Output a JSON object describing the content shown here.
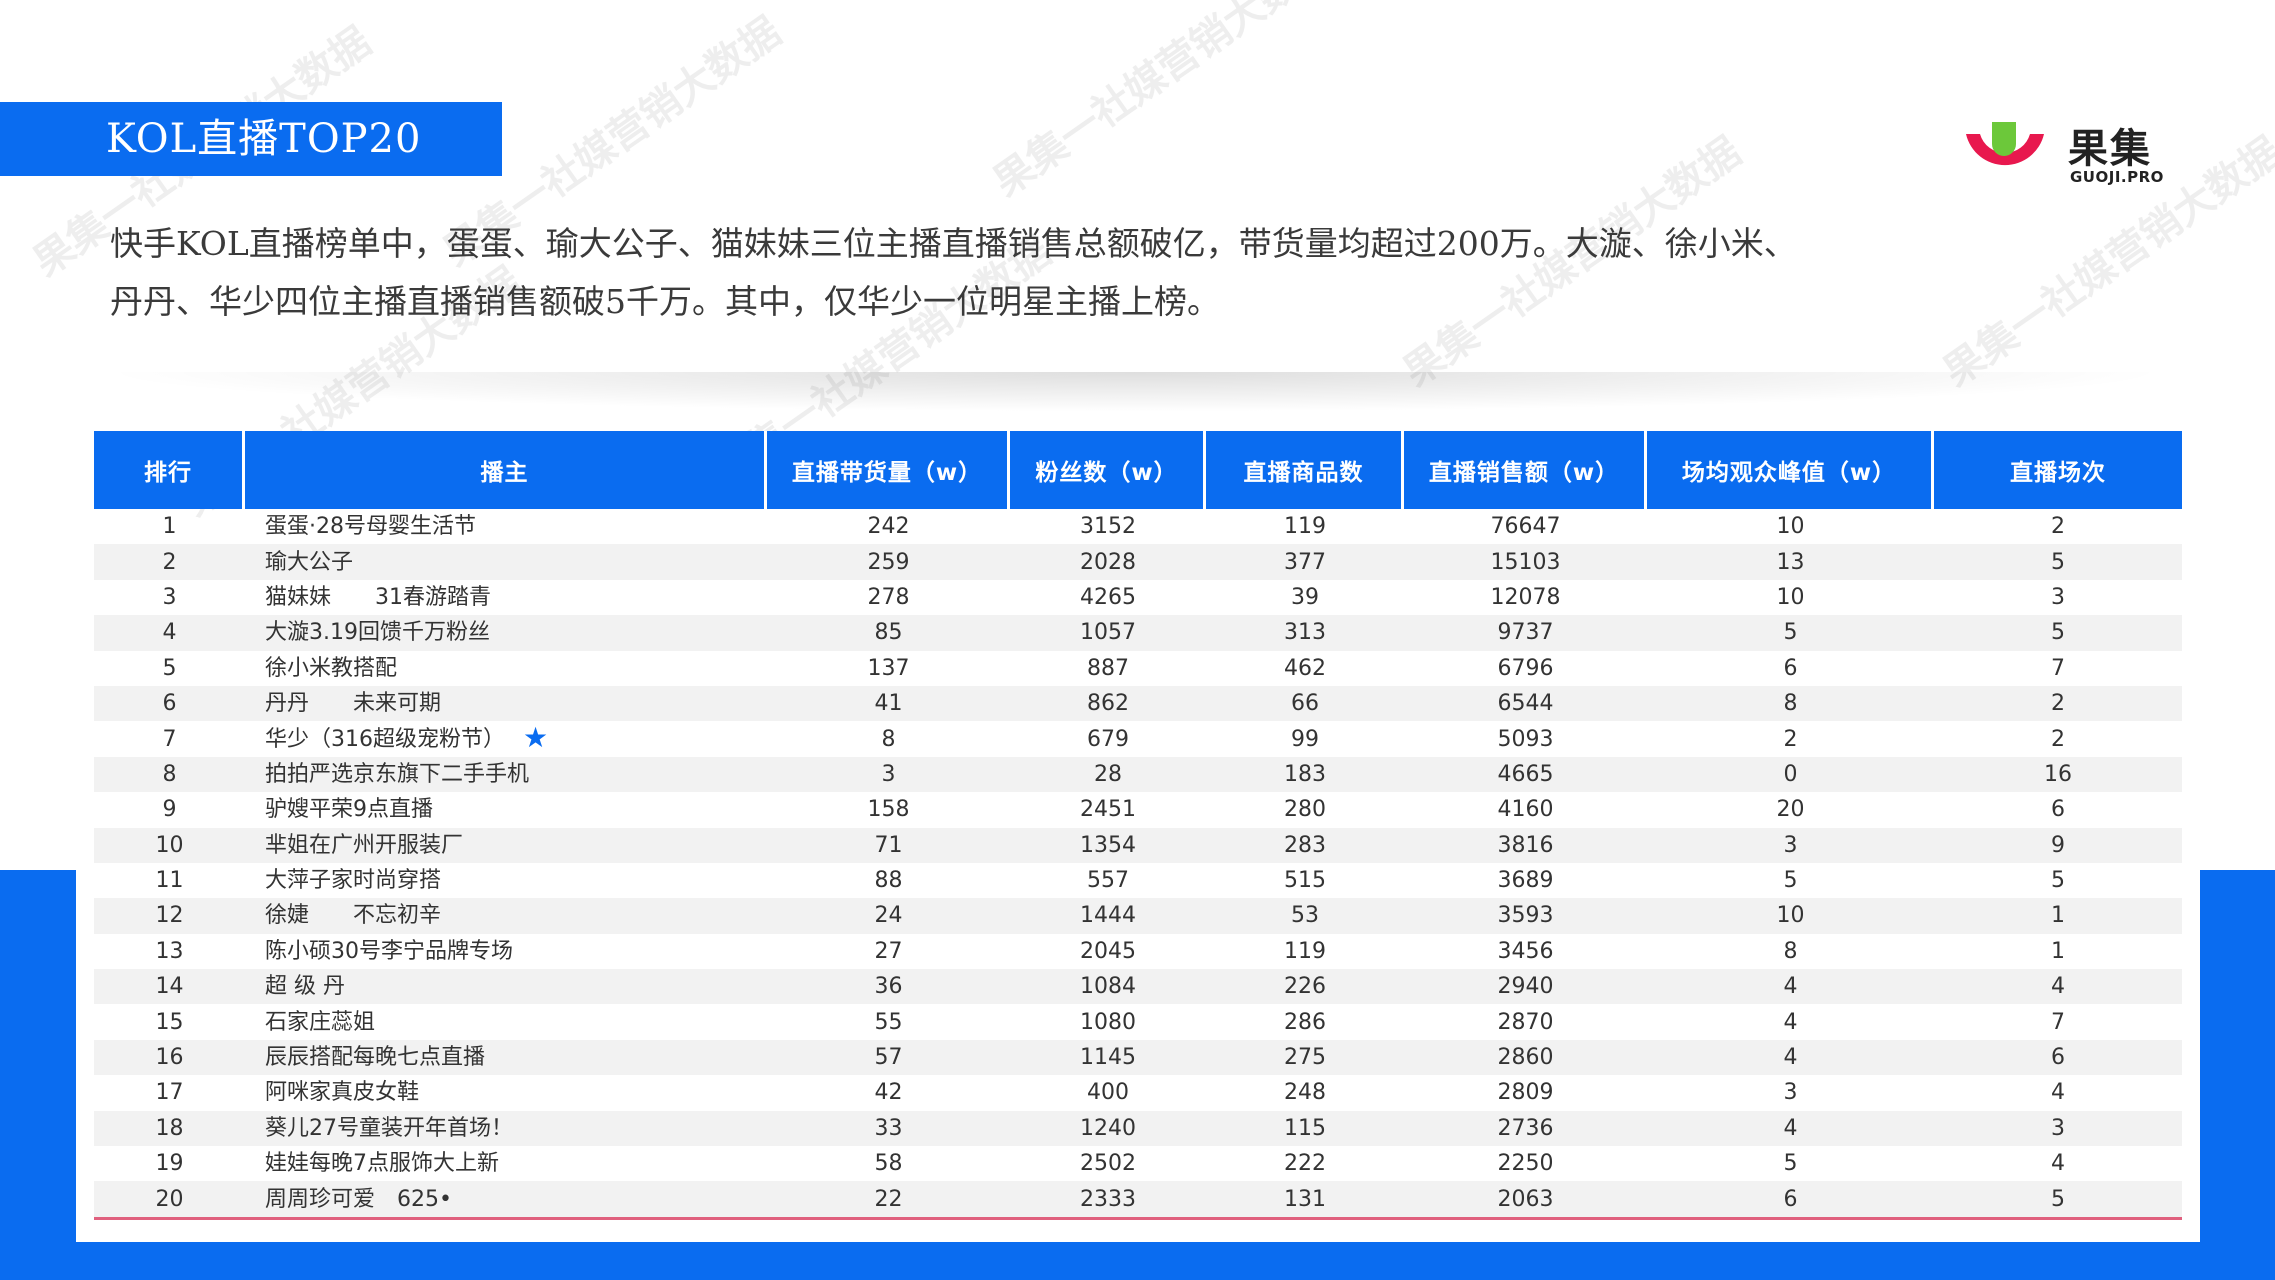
{
  "title": "KOL直播TOP20",
  "logo": {
    "cn": "果集",
    "en": "GUOJI.PRO"
  },
  "intro": [
    "快手KOL直播榜单中，蛋蛋、瑜大公子、猫妹妹三位主播直播销售总额破亿，带货量均超过200万。大漩、徐小米、",
    "丹丹、华少四位主播直播销售额破5千万。其中，仅华少一位明星主播上榜。"
  ],
  "watermark": "果集一社媒营销大数据",
  "table": {
    "headers": [
      "排行",
      "播主",
      "直播带货量（w）",
      "粉丝数（w）",
      "直播商品数",
      "直播销售额（w）",
      "场均观众峰值（w）",
      "直播场次"
    ],
    "rows": [
      [
        "1",
        "蛋蛋·28号母婴生活节",
        "242",
        "3152",
        "119",
        "76647",
        "10",
        "2"
      ],
      [
        "2",
        "瑜大公子",
        "259",
        "2028",
        "377",
        "15103",
        "13",
        "5"
      ],
      [
        "3",
        "猫妹妹　　31春游踏青",
        "278",
        "4265",
        "39",
        "12078",
        "10",
        "3"
      ],
      [
        "4",
        "大漩3.19回馈千万粉丝",
        "85",
        "1057",
        "313",
        "9737",
        "5",
        "5"
      ],
      [
        "5",
        "徐小米教搭配",
        "137",
        "887",
        "462",
        "6796",
        "6",
        "7"
      ],
      [
        "6",
        "丹丹　　未来可期",
        "41",
        "862",
        "66",
        "6544",
        "8",
        "2"
      ],
      [
        "7",
        "华少（316超级宠粉节）",
        "8",
        "679",
        "99",
        "5093",
        "2",
        "2"
      ],
      [
        "8",
        "拍拍严选京东旗下二手手机",
        "3",
        "28",
        "183",
        "4665",
        "0",
        "16"
      ],
      [
        "9",
        "驴嫂平荣9点直播",
        "158",
        "2451",
        "280",
        "4160",
        "20",
        "6"
      ],
      [
        "10",
        "芈姐在广州开服装厂",
        "71",
        "1354",
        "283",
        "3816",
        "3",
        "9"
      ],
      [
        "11",
        "大萍子家时尚穿搭",
        "88",
        "557",
        "515",
        "3689",
        "5",
        "5"
      ],
      [
        "12",
        "徐婕　　不忘初辛",
        "24",
        "1444",
        "53",
        "3593",
        "10",
        "1"
      ],
      [
        "13",
        "陈小硕30号李宁品牌专场",
        "27",
        "2045",
        "119",
        "3456",
        "8",
        "1"
      ],
      [
        "14",
        "超 级 丹",
        "36",
        "1084",
        "226",
        "2940",
        "4",
        "4"
      ],
      [
        "15",
        "石家庄蕊姐",
        "55",
        "1080",
        "286",
        "2870",
        "4",
        "7"
      ],
      [
        "16",
        "辰辰搭配每晚七点直播",
        "57",
        "1145",
        "275",
        "2860",
        "4",
        "6"
      ],
      [
        "17",
        "阿咪家真皮女鞋",
        "42",
        "400",
        "248",
        "2809",
        "3",
        "4"
      ],
      [
        "18",
        "葵儿27号童装开年首场！",
        "33",
        "1240",
        "115",
        "2736",
        "4",
        "3"
      ],
      [
        "19",
        "娃娃每晚7点服饰大上新",
        "58",
        "2502",
        "222",
        "2250",
        "5",
        "4"
      ],
      [
        "20",
        "周周珍可爱　625•",
        "22",
        "2333",
        "131",
        "2063",
        "6",
        "5"
      ]
    ],
    "star_row": 6,
    "star_glyph": "★"
  },
  "colors": {
    "brand_blue": "#0a6cf0",
    "accent_pink": "#e0607e"
  }
}
